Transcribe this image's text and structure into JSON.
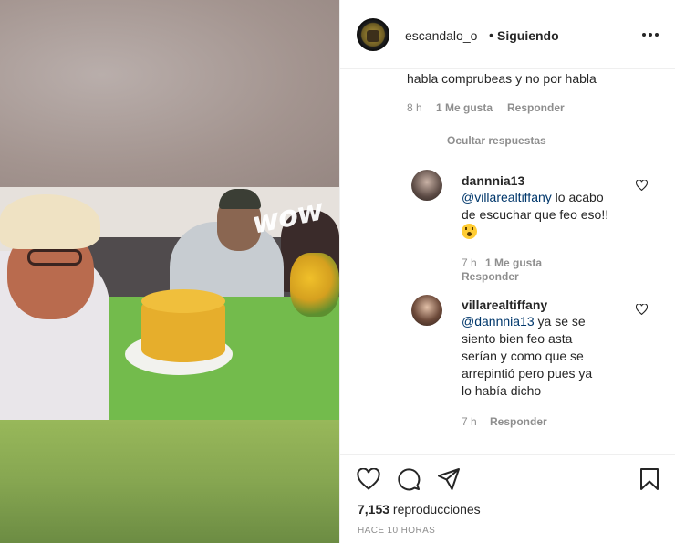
{
  "post": {
    "username": "escandalo_o",
    "separator": "•",
    "follow_status": "Siguiendo",
    "video_watermark": "wow"
  },
  "comments": {
    "parent_tail": "habla comprubeas y no por habla",
    "parent_time": "8 h",
    "parent_likes": "1 Me gusta",
    "parent_reply": "Responder",
    "hide_replies": "Ocultar respuestas",
    "replies": [
      {
        "username": "dannnia13",
        "mention": "@villarealtiffany",
        "line1_rest": " lo acabo",
        "line2": "de escuchar que feo eso!!",
        "emoji": "astonished-face",
        "time": "7 h",
        "likes": "1 Me gusta",
        "reply": "Responder"
      },
      {
        "username": "villarealtiffany",
        "mention": "@dannnia13",
        "line1_rest": " ya se se",
        "line2": "siento bien feo asta",
        "line3": "serían y como que se",
        "line4": "arrepintió pero pues ya",
        "line5": "lo había dicho",
        "time": "7 h",
        "reply": "Responder"
      }
    ]
  },
  "actions": {
    "like": "heart-icon",
    "comment": "comment-icon",
    "share": "share-icon",
    "save": "bookmark-icon"
  },
  "stats": {
    "views_count": "7,153",
    "views_label": " reproducciones",
    "posted_ago": "HACE 10 HORAS"
  },
  "colors": {
    "text": "#262626",
    "secondary": "#8e8e8e",
    "mention": "#00376b",
    "divider": "#efefef"
  }
}
